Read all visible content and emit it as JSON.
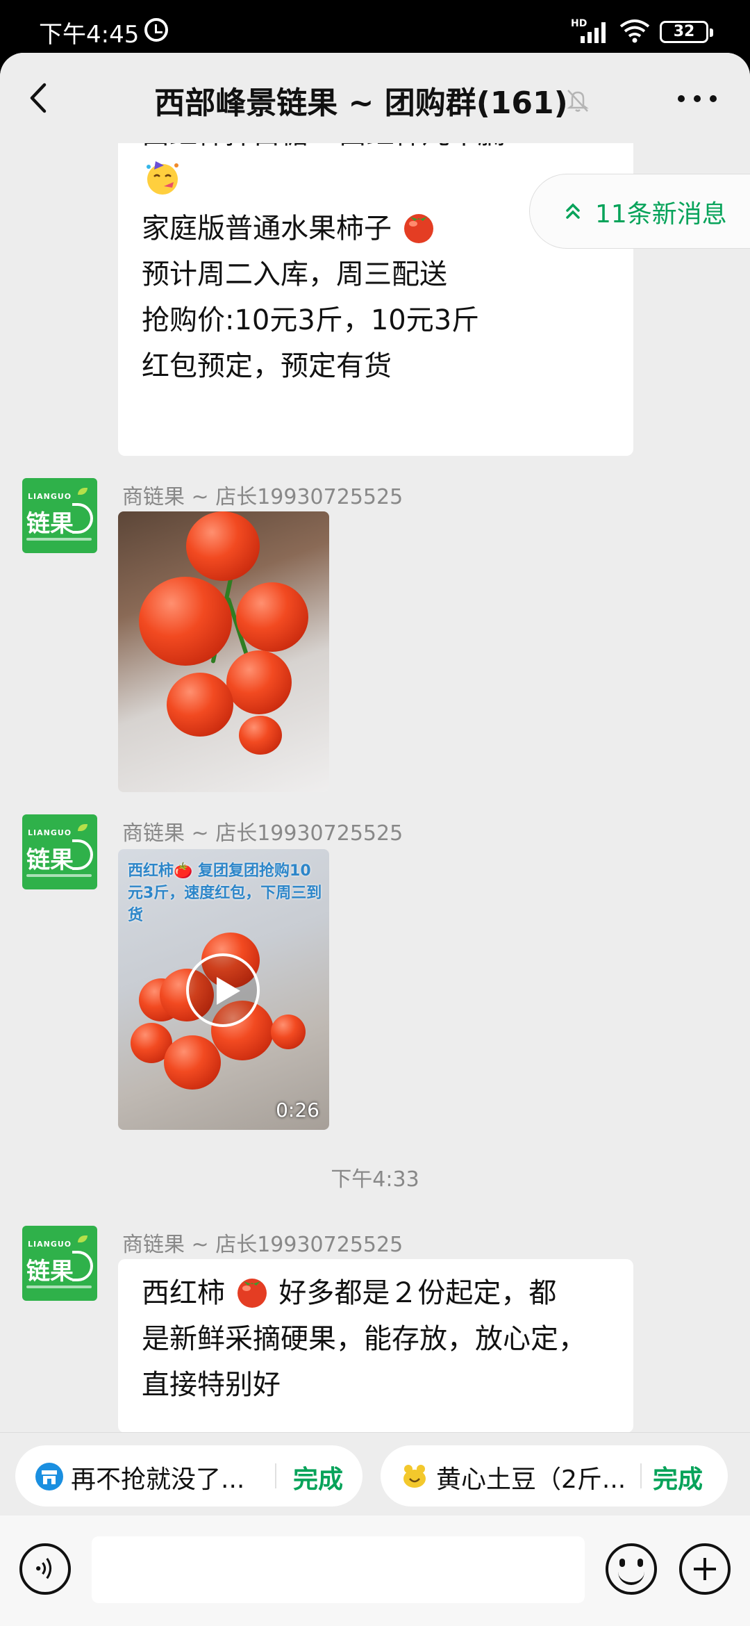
{
  "status_bar": {
    "time": "下午4:45",
    "network_label": "HD",
    "battery": "32"
  },
  "header": {
    "title": "西部峰景链果 ~ 团购群(161)"
  },
  "new_messages": {
    "label": "11条新消息"
  },
  "messages": [
    {
      "type": "text",
      "lines": [
        {
          "parts": [
            "西红柿拌白糖",
            "!",
            " 西红柿炖牛腩"
          ]
        },
        {
          "parts": []
        },
        {
          "parts": [
            "家庭版普通水果柿子"
          ]
        },
        {
          "parts": [
            "预计周二入库，周三配送"
          ]
        },
        {
          "parts": [
            ""
          ]
        },
        {
          "parts": [
            "抢购价:10元3斤，10元3斤"
          ]
        },
        {
          "parts": [
            "红包预定，预定有货"
          ]
        }
      ]
    },
    {
      "type": "image",
      "sender": "商链果 ~ 店长19930725525"
    },
    {
      "type": "video",
      "sender": "商链果 ~ 店长19930725525",
      "caption": "西红柿🍅 复团复团抢购10元3斤，速度红包，下周三到货",
      "duration": "0:26"
    },
    {
      "type": "timestamp",
      "text": "下午4:33"
    },
    {
      "type": "text",
      "sender": "商链果 ~ 店长19930725525",
      "lines": [
        {
          "parts": [
            "西红柿",
            " 好多都是２份起定，都"
          ]
        },
        {
          "parts": [
            "是新鲜采摘硬果，能存放，放心定，"
          ]
        },
        {
          "parts": [
            "直接特别好"
          ]
        }
      ]
    }
  ],
  "avatar": {
    "brand_en": "LIANGUO",
    "brand_cn": "链果"
  },
  "quick_actions": [
    {
      "label": "再不抢就没了...",
      "action": "完成",
      "icon": "market-icon"
    },
    {
      "label": "黄心土豆（2斤...",
      "action": "完成",
      "icon": "potato-icon"
    }
  ],
  "colors": {
    "accent": "#07a35a",
    "background": "#ededed",
    "bubble": "#ffffff",
    "avatar": "#2fb14a"
  }
}
